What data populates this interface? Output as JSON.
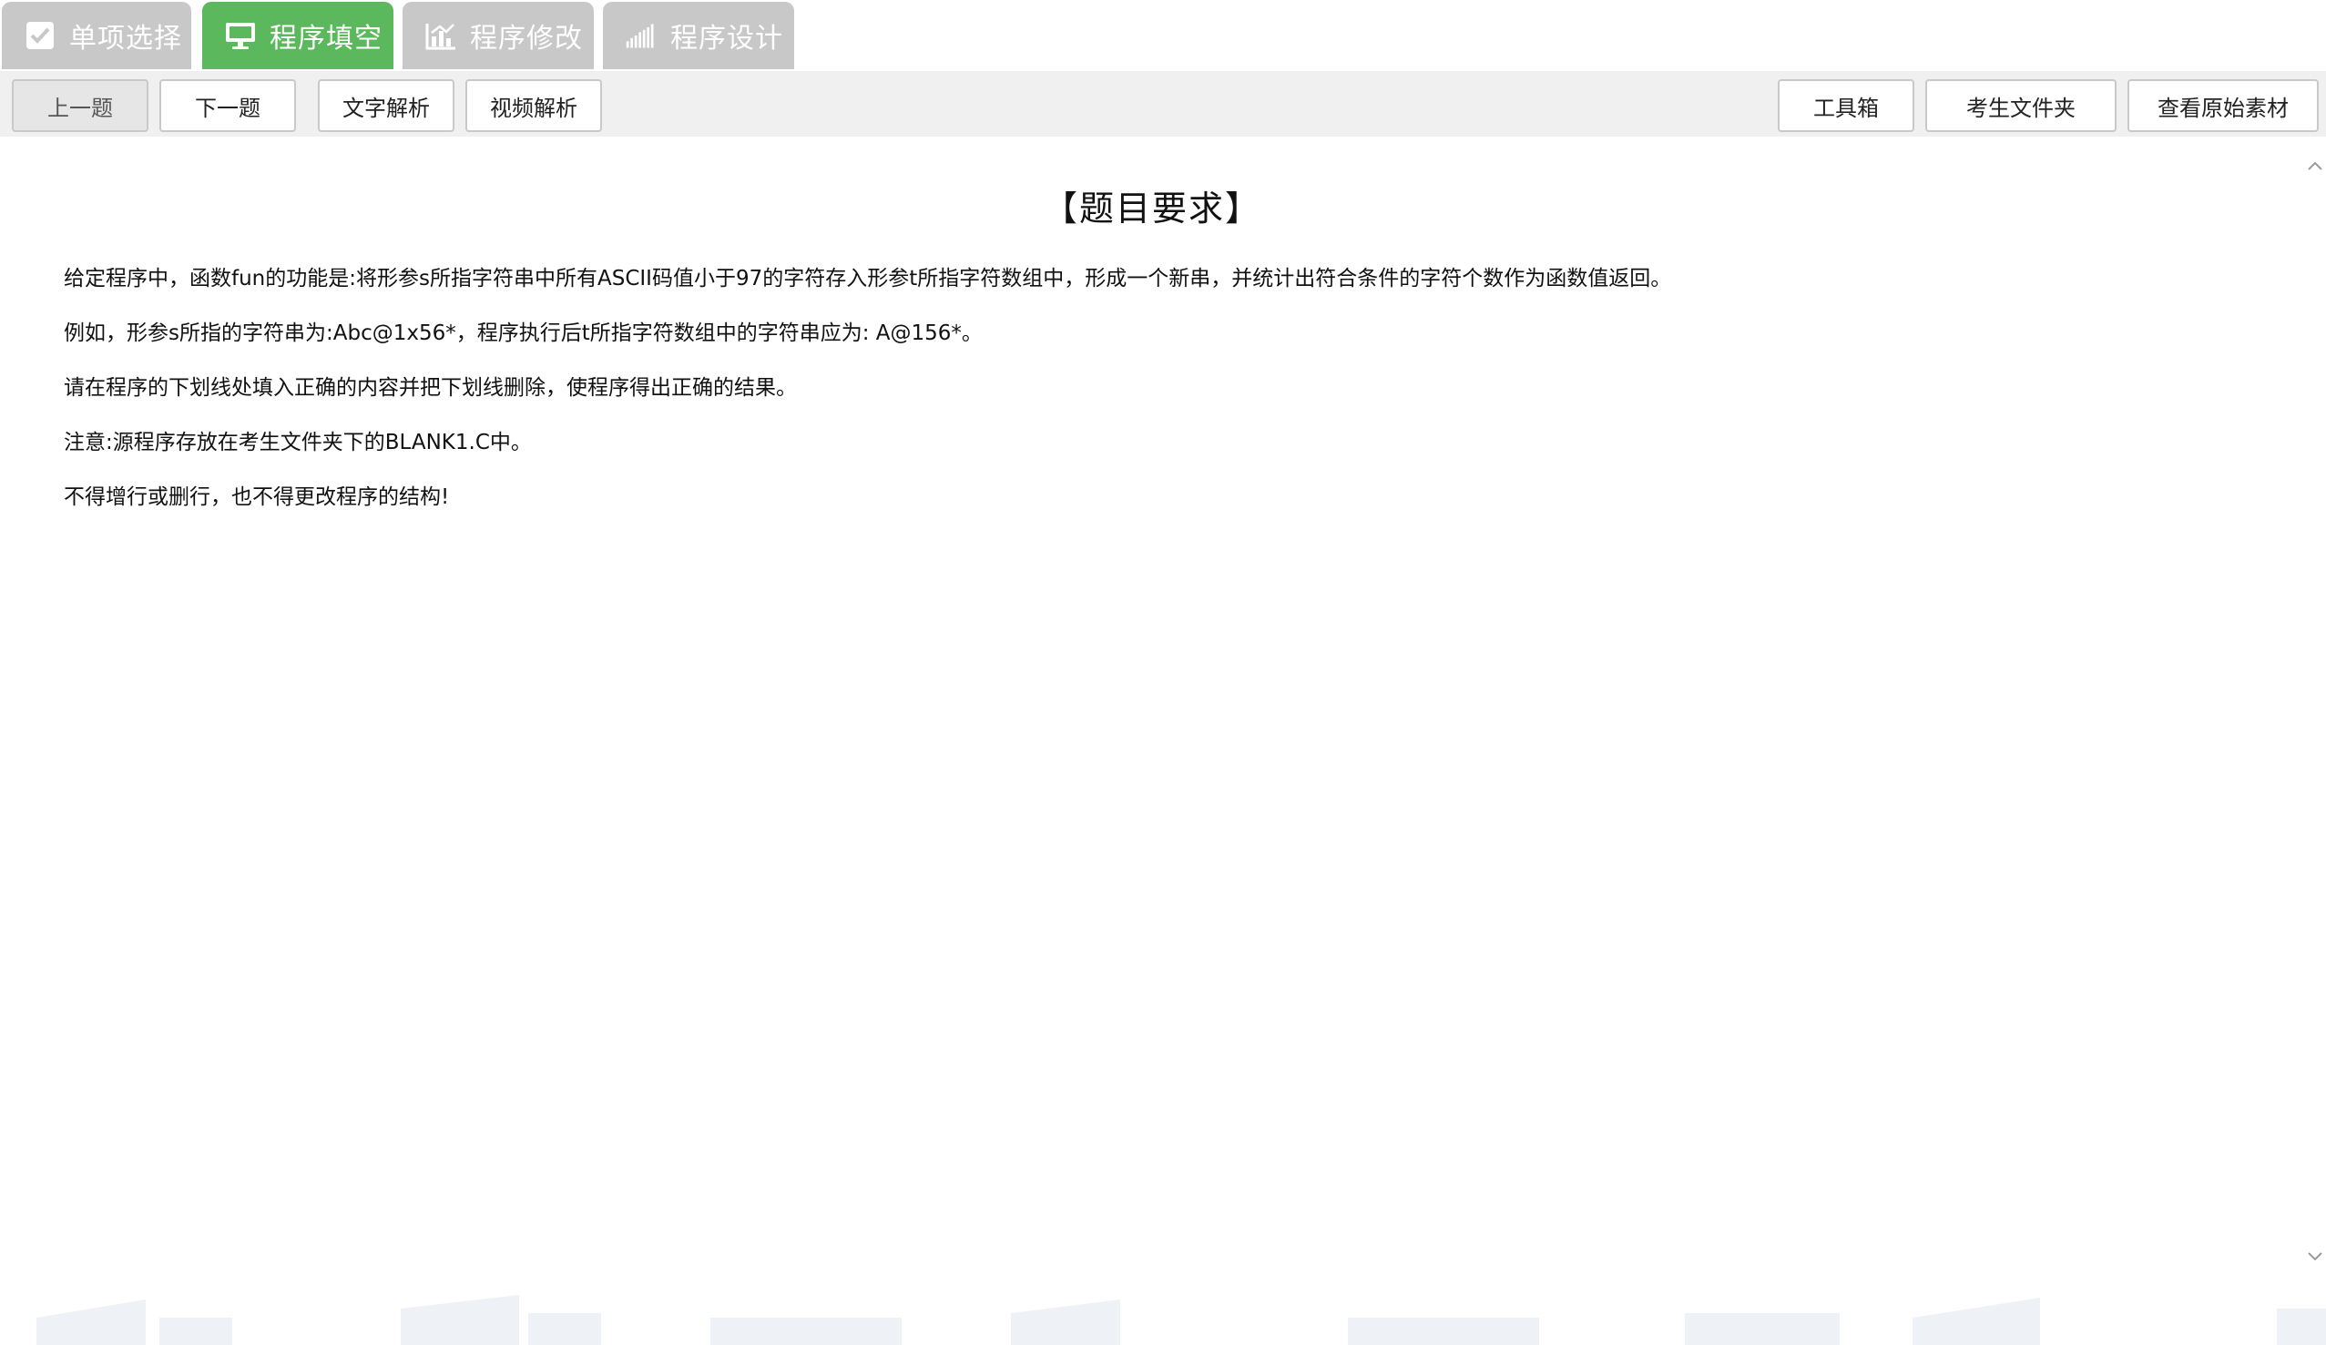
{
  "tabs": [
    {
      "label": "单项选择",
      "icon": "checkbox-icon",
      "active": false
    },
    {
      "label": "程序填空",
      "icon": "monitor-icon",
      "active": true
    },
    {
      "label": "程序修改",
      "icon": "bar-chart-icon",
      "active": false
    },
    {
      "label": "程序设计",
      "icon": "signal-bars-icon",
      "active": false
    }
  ],
  "toolbar": {
    "prev": "上一题",
    "next": "下一题",
    "text_analysis": "文字解析",
    "video_analysis": "视频解析",
    "toolbox": "工具箱",
    "examinee_folder": "考生文件夹",
    "view_original": "查看原始素材"
  },
  "question": {
    "heading": "【题目要求】",
    "paragraphs": [
      "给定程序中，函数fun的功能是:将形参s所指字符串中所有ASCII码值小于97的字符存入形参t所指字符数组中，形成一个新串，并统计出符合条件的字符个数作为函数值返回。",
      "例如，形参s所指的字符串为:Abc@1x56*，程序执行后t所指字符数组中的字符串应为: A@156*。",
      "请在程序的下划线处填入正确的内容并把下划线删除，使程序得出正确的结果。",
      "注意:源程序存放在考生文件夹下的BLANK1.C中。",
      "不得增行或删行，也不得更改程序的结构!"
    ]
  },
  "colors": {
    "tab_active": "#5cb85c",
    "tab_inactive": "#c8c8c8",
    "toolbar_bg": "#f0f0f0"
  }
}
